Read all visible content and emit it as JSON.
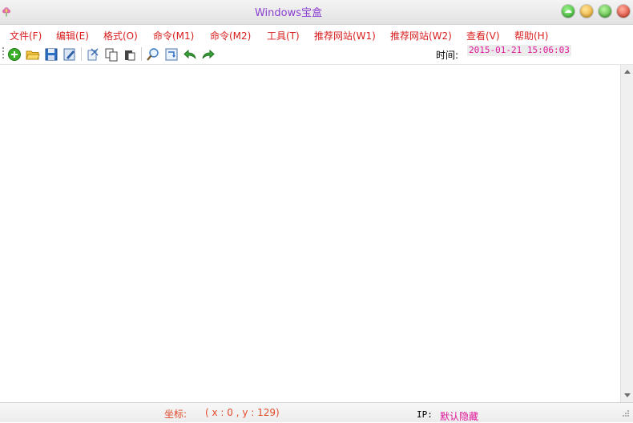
{
  "window": {
    "title": "Windows宝盒",
    "icons": {
      "app": "flower-icon",
      "cloud": "cloud-icon",
      "minimize": "minimize-icon",
      "maximize": "maximize-icon",
      "close": "close-icon"
    }
  },
  "menu": {
    "items": [
      {
        "label": "文件(F)"
      },
      {
        "label": "编辑(E)"
      },
      {
        "label": "格式(O)"
      },
      {
        "label": "命令(M1)"
      },
      {
        "label": "命令(M2)"
      },
      {
        "label": "工具(T)"
      },
      {
        "label": "推荐网站(W1)"
      },
      {
        "label": "推荐网站(W2)"
      },
      {
        "label": "查看(V)"
      },
      {
        "label": "帮助(H)"
      }
    ]
  },
  "toolbar": {
    "buttons": [
      "new-icon",
      "open-icon",
      "save-icon",
      "edit-icon",
      "cut-icon",
      "copy-icon",
      "paste-icon",
      "find-icon",
      "replace-icon",
      "undo-icon",
      "redo-icon"
    ],
    "time_label": "时间:",
    "time_value": "2015-01-21 15:06:03"
  },
  "status": {
    "coord_label": "坐标:",
    "coord_value": "( x : 0 , y : 129)",
    "ip_label": "IP:",
    "ip_value": "默认隐藏"
  },
  "colors": {
    "menu_text": "#d81e1e",
    "title_text": "#8a3fd0",
    "time_text": "#e0189a",
    "coord_text": "#e24a2a"
  }
}
